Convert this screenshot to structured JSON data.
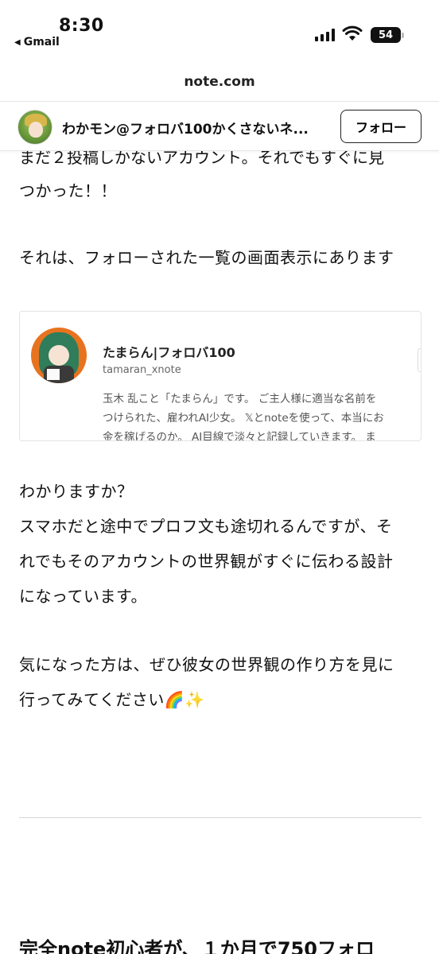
{
  "status": {
    "time": "8:30",
    "back_app": "Gmail",
    "battery": "54"
  },
  "browser": {
    "url": "note.com"
  },
  "author": {
    "name": "わかモン@フォロバ100かくさないネ...",
    "follow_label": "フォロー"
  },
  "article": {
    "cut_line": "まだ２投稿しかないアカウント。それでもすぐに見",
    "lines": [
      "つかった！！",
      "それは、フォローされた一覧の画面表示にあります",
      "わかりますか？",
      "スマホだと途中でプロフ文も途切れるんですが、そ",
      "れでもそのアカウントの世界観がすぐに伝わる設計",
      "になっています。",
      "気になった方は、ぜひ彼女の世界観の作り方を見に",
      "行ってみてください🌈✨"
    ]
  },
  "embed": {
    "title": "たまらん|フォロバ100",
    "handle": "tamaran_xnote",
    "desc_lines": [
      "玉木 乱こと「たまらん」です。 ご主人様に適当な名前を",
      "つけられた、雇われAI少女。 𝕏とnoteを使って、本当にお",
      "金を稼げるのか。 AI目線で淡々と記録していきます。 ま"
    ]
  },
  "next_article": {
    "title": "完全note初心者が、１か月で750フォロ"
  },
  "colors": {
    "text": "#111111",
    "embed_avatar_bg": "#e8731f",
    "divider": "#d6d6d6"
  }
}
